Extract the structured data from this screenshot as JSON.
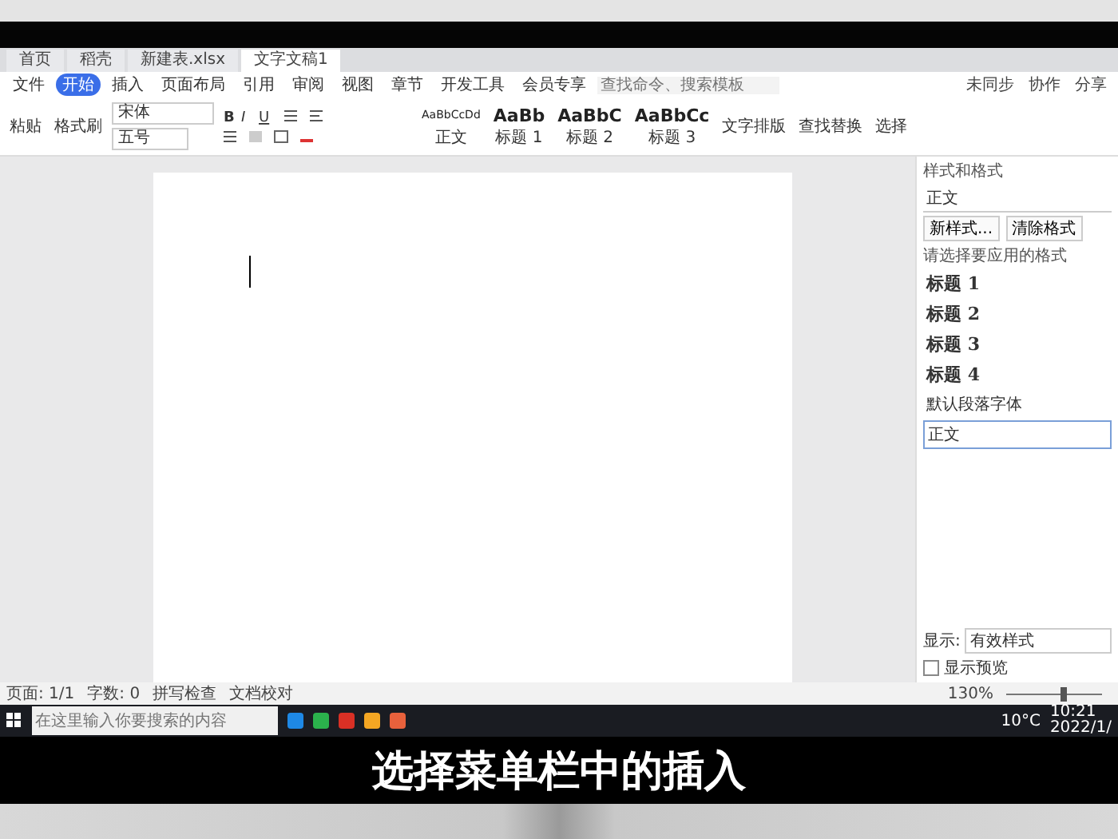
{
  "tabs": [
    {
      "label": "首页",
      "selected": false
    },
    {
      "label": "稻壳",
      "selected": false
    },
    {
      "label": "新建表.xlsx",
      "selected": false
    },
    {
      "label": "文字文稿1",
      "selected": true
    }
  ],
  "menu": [
    {
      "label": "文件",
      "selected": false
    },
    {
      "label": "开始",
      "selected": true
    },
    {
      "label": "插入",
      "selected": false
    },
    {
      "label": "页面布局",
      "selected": false
    },
    {
      "label": "引用",
      "selected": false
    },
    {
      "label": "审阅",
      "selected": false
    },
    {
      "label": "视图",
      "selected": false
    },
    {
      "label": "章节",
      "selected": false
    },
    {
      "label": "开发工具",
      "selected": false
    },
    {
      "label": "会员专享",
      "selected": false
    }
  ],
  "search": {
    "placeholder": "查找命令、搜索模板"
  },
  "account": [
    "未同步",
    "协作",
    "分享"
  ],
  "tools": [
    "粘贴",
    "格式刷"
  ],
  "font": {
    "name": "宋体",
    "size": "五号"
  },
  "format_buttons": [
    "B",
    "I",
    "U"
  ],
  "styles": [
    {
      "sample": "AaBbCcDd",
      "label": "正文"
    },
    {
      "sample": "AaBb",
      "label": "标题 1"
    },
    {
      "sample": "AaBbC",
      "label": "标题 2"
    },
    {
      "sample": "AaBbCc",
      "label": "标题 3"
    }
  ],
  "actions": [
    "文字排版",
    "查找替换",
    "选择"
  ],
  "panel": {
    "title": "样式和格式",
    "current": "正文",
    "buttons": [
      "新样式...",
      "清除格式"
    ],
    "prompt": "请选择要应用的格式",
    "items": [
      {
        "label": "标题 1",
        "kind": "heading",
        "selected": false
      },
      {
        "label": "标题 2",
        "kind": "heading",
        "selected": false
      },
      {
        "label": "标题 3",
        "kind": "heading",
        "selected": false
      },
      {
        "label": "标题 4",
        "kind": "heading",
        "selected": false
      },
      {
        "label": "默认段落字体",
        "kind": "plain",
        "selected": false
      },
      {
        "label": "正文",
        "kind": "plain",
        "selected": true
      }
    ],
    "show_label": "显示:",
    "show_value": "有效样式",
    "preview": {
      "label": "显示预览",
      "checked": false
    }
  },
  "status": {
    "items": [
      "页面: 1/1",
      "字数: 0",
      "拼写检查",
      "文档校对"
    ],
    "zoom": "130%",
    "zoom_slider": {
      "level": 0.6
    }
  },
  "taskbar": {
    "placeholder": "在这里输入你要搜索的内容",
    "weather": "10°C",
    "time": "10:21",
    "date": "2022/1/"
  },
  "caption": "选择菜单栏中的插入"
}
